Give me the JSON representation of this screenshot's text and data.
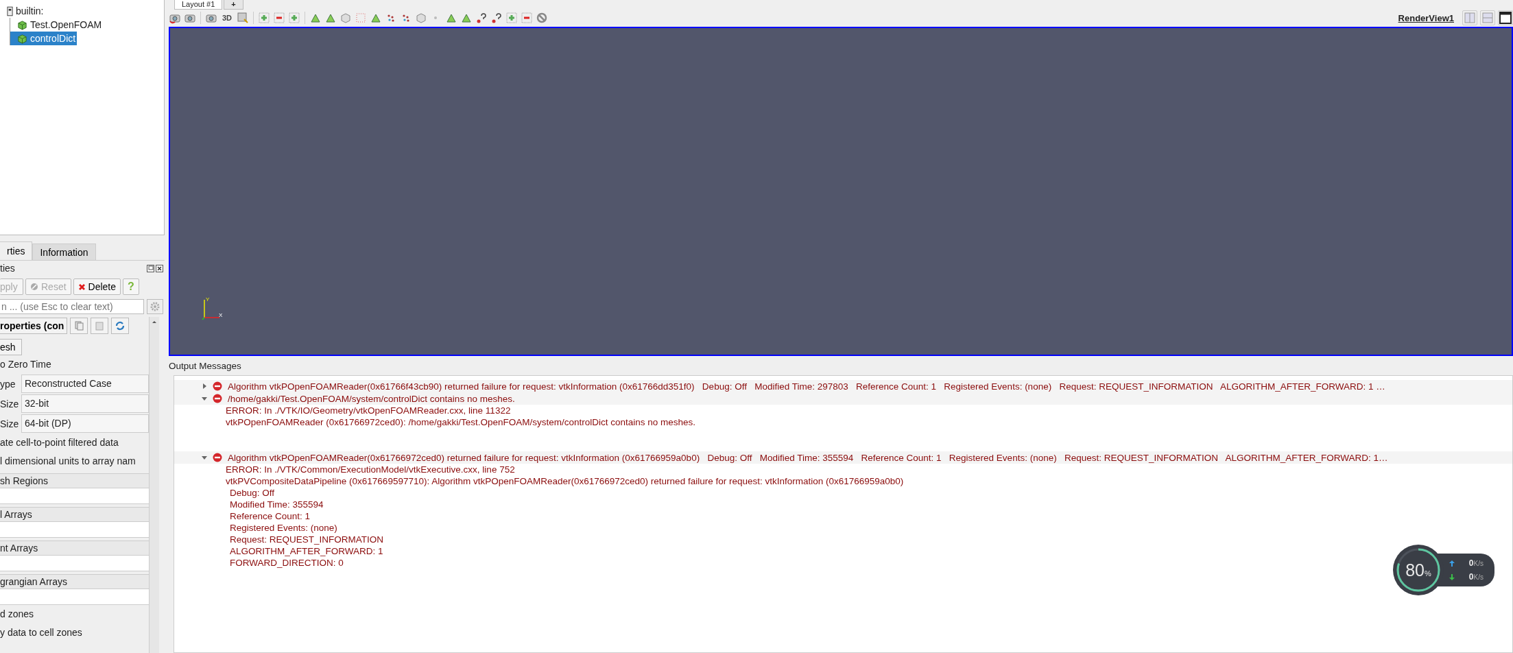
{
  "pipeline_tree": [
    {
      "label": "builtin:",
      "kind": "server",
      "selected": false,
      "children": [
        {
          "label": "Test.OpenFOAM",
          "kind": "source",
          "selected": false
        },
        {
          "label": "controlDict",
          "kind": "source",
          "selected": true
        }
      ]
    }
  ],
  "panel_tabs": [
    {
      "label": "rties",
      "selected": true
    },
    {
      "label": "Information",
      "selected": false
    }
  ],
  "panel_title": "ties",
  "panel_buttons": [
    {
      "kind": "apply",
      "label": "pply",
      "disabled": true
    },
    {
      "kind": "reset",
      "label": "Reset",
      "disabled": true
    },
    {
      "kind": "delete",
      "label": "Delete",
      "disabled": false
    },
    {
      "kind": "help",
      "label": "?",
      "disabled": false
    }
  ],
  "search": {
    "placeholder": "n ... (use Esc to clear text)"
  },
  "section_title": "roperties (con",
  "properties": [
    {
      "kind": "button",
      "label": "esh"
    },
    {
      "kind": "text",
      "label": "o Zero Time"
    },
    {
      "kind": "combo",
      "label": "ype",
      "value": "Reconstructed Case"
    },
    {
      "kind": "combo",
      "label": "Size",
      "value": "32-bit"
    },
    {
      "kind": "combo",
      "label": "Size",
      "value": "64-bit (DP)"
    },
    {
      "kind": "text",
      "label": "ate cell-to-point filtered data"
    },
    {
      "kind": "text",
      "label": "l dimensional units to array nam"
    },
    {
      "kind": "list",
      "label": "sh Regions"
    },
    {
      "kind": "list",
      "label": "l Arrays"
    },
    {
      "kind": "list",
      "label": "nt Arrays"
    },
    {
      "kind": "list",
      "label": "grangian Arrays"
    },
    {
      "kind": "text",
      "label": "d zones"
    },
    {
      "kind": "text",
      "label": "y data to cell zones"
    }
  ],
  "layout_tab": {
    "label": "Layout #1",
    "add": "+"
  },
  "toolbar": {
    "view_mode": "3D",
    "view_name": "RenderView1"
  },
  "axes": {
    "x": "X",
    "y": "Y"
  },
  "output_title": "Output Messages",
  "messages": [
    {
      "expanded": false,
      "text": "Algorithm vtkPOpenFOAMReader(0x61766f43cb90) returned failure for request: vtkInformation (0x61766dd351f0)   Debug: Off   Modified Time: 297803   Reference Count: 1   Registered Events: (none)   Request: REQUEST_INFORMATION   ALGORITHM_AFTER_FORWARD: 1 …"
    },
    {
      "expanded": true,
      "text": "/home/gakki/Test.OpenFOAM/system/controlDict contains no meshes.",
      "details": [
        {
          "text": "ERROR: In ./VTK/IO/Geometry/vtkOpenFOAMReader.cxx, line 11322"
        },
        {
          "text": "vtkPOpenFOAMReader (0x61766972ced0): /home/gakki/Test.OpenFOAM/system/controlDict contains no meshes."
        }
      ]
    },
    {
      "expanded": true,
      "text": "Algorithm vtkPOpenFOAMReader(0x61766972ced0) returned failure for request: vtkInformation (0x61766959a0b0)   Debug: Off   Modified Time: 355594   Reference Count: 1   Registered Events: (none)   Request: REQUEST_INFORMATION   ALGORITHM_AFTER_FORWARD: 1…",
      "details": [
        {
          "text": "ERROR: In ./VTK/Common/ExecutionModel/vtkExecutive.cxx, line 752"
        },
        {
          "text": "vtkPVCompositeDataPipeline (0x617669597710): Algorithm vtkPOpenFOAMReader(0x61766972ced0) returned failure for request: vtkInformation (0x61766959a0b0)",
          "children": [
            {
              "text": "Debug: Off"
            },
            {
              "text": "Modified Time: 355594"
            },
            {
              "text": "Reference Count: 1"
            },
            {
              "text": "Registered Events: (none)"
            },
            {
              "text": "Request: REQUEST_INFORMATION"
            },
            {
              "text": "ALGORITHM_AFTER_FORWARD: 1"
            },
            {
              "text": "FORWARD_DIRECTION: 0"
            }
          ]
        }
      ]
    }
  ],
  "monitor": {
    "value": "80",
    "unit": "%",
    "level": 0.8,
    "rates": [
      {
        "kind": "up",
        "value": "0",
        "unit": "K/s"
      },
      {
        "kind": "down",
        "value": "0",
        "unit": "K/s"
      }
    ]
  }
}
